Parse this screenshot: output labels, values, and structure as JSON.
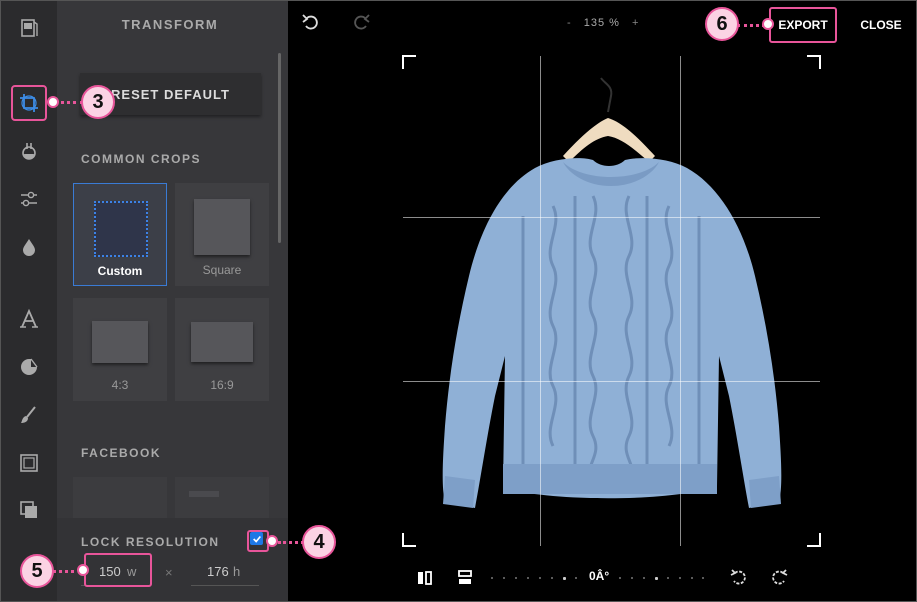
{
  "panel": {
    "title": "TRANSFORM",
    "reset_label": "RESET DEFAULT",
    "common_crops_label": "COMMON CROPS",
    "crops": [
      {
        "label": "Custom",
        "selected": true
      },
      {
        "label": "Square"
      },
      {
        "label": "4:3"
      },
      {
        "label": "16:9"
      }
    ],
    "facebook_label": "FACEBOOK",
    "lock_resolution_label": "LOCK RESOLUTION",
    "lock_checked": true,
    "width_value": "150",
    "width_unit": "w",
    "height_value": "176",
    "height_unit": "h",
    "times_sign": "×"
  },
  "rail": {
    "items": [
      "document-icon",
      "crop-icon",
      "filter-icon",
      "adjust-icon",
      "drop-icon",
      "text-icon",
      "sticker-icon",
      "brush-icon",
      "frame-icon",
      "overlay-icon"
    ],
    "active": "crop-icon"
  },
  "topbar": {
    "zoom_minus": "-",
    "zoom_value": "135 %",
    "zoom_plus": "+",
    "export_label": "EXPORT",
    "close_label": "CLOSE"
  },
  "bottombar": {
    "rotation_value": "0Â°"
  },
  "callouts": {
    "c3": "3",
    "c4": "4",
    "c5": "5",
    "c6": "6"
  },
  "colors": {
    "accent": "#e8559a",
    "selection_blue": "#3a7bd5",
    "sweater": "#8fb0d6"
  }
}
